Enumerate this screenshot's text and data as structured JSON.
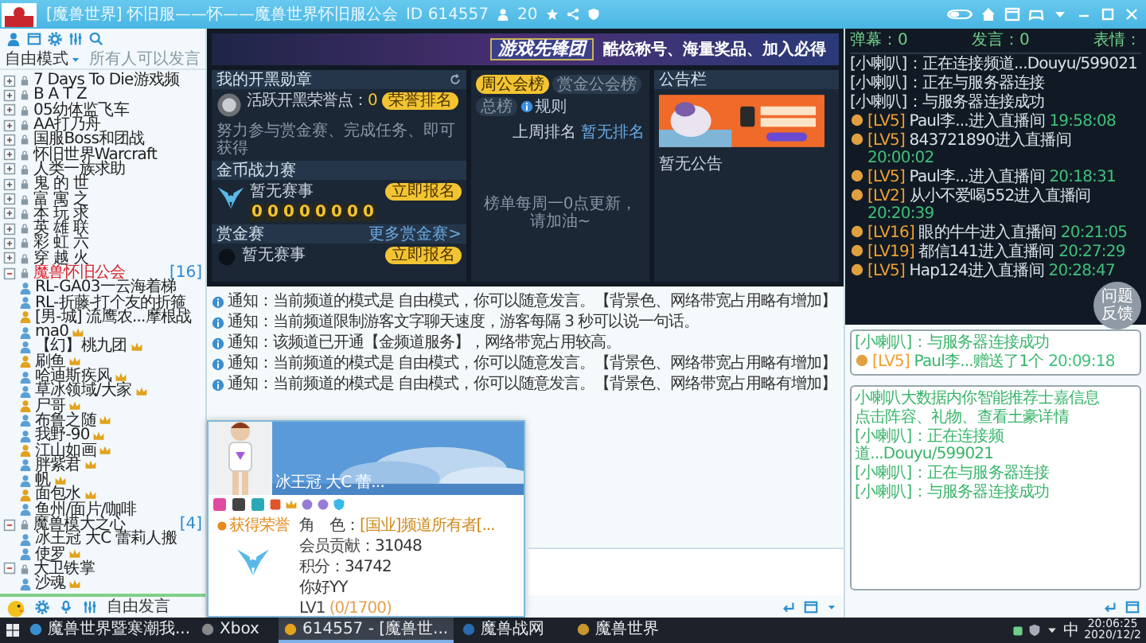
{
  "window": {
    "title": "[魔兽世界] 怀旧服——怀——魔兽世界怀旧服公会",
    "channel_id": "ID 614557",
    "online": "20"
  },
  "sidebar": {
    "mode": "自由模式",
    "speak_rule": "所有人可以发言",
    "channels": [
      {
        "name": "7 Days To Die游戏频",
        "expanded": false,
        "current": false
      },
      {
        "name": "B A T Z",
        "expanded": false,
        "current": false
      },
      {
        "name": "05幼体监飞车",
        "expanded": false,
        "current": false
      },
      {
        "name": "AA打乃舟",
        "expanded": false,
        "current": false
      },
      {
        "name": "国服Boss和团战",
        "expanded": false,
        "current": false
      },
      {
        "name": "怀旧世界Warcraft",
        "expanded": false,
        "current": false
      },
      {
        "name": "人类一族求助",
        "expanded": false,
        "current": false
      },
      {
        "name": "鬼 的 世",
        "expanded": false,
        "current": false
      },
      {
        "name": "富 寓 之",
        "expanded": false,
        "current": false
      },
      {
        "name": "本 玩 求",
        "expanded": false,
        "current": false
      },
      {
        "name": "英 雄 联",
        "expanded": false,
        "current": false
      },
      {
        "name": "彩 虹 六",
        "expanded": false,
        "current": false
      },
      {
        "name": "穿 越 火",
        "expanded": false,
        "current": false
      },
      {
        "name": "魔兽怀旧公会",
        "count": "[16]",
        "expanded": true,
        "current": true,
        "children": [
          {
            "name": "RL-GA03一云海着梯"
          },
          {
            "name": "RL-折藤-打个友的折箍"
          },
          {
            "name": "[男-城] 流鹰农...摩根战"
          },
          {
            "name": "ma0"
          },
          {
            "name": "【幻】桃九团"
          },
          {
            "name": "刷鱼"
          },
          {
            "name": "哈迪斯疾风"
          },
          {
            "name": "草冰领域/大家"
          },
          {
            "name": "尸哥"
          },
          {
            "name": "布鲁之随"
          },
          {
            "name": "我野-90"
          },
          {
            "name": "江山如画"
          },
          {
            "name": "胖紫君"
          },
          {
            "name": "帆"
          },
          {
            "name": "面包水"
          },
          {
            "name": "鱼州/面片/咖啡"
          }
        ]
      },
      {
        "name": "魔兽模大之心",
        "count": "[4]",
        "expanded": true,
        "current": false,
        "children": [
          {
            "name": "冰王冠 大C 蕾莉人搬"
          },
          {
            "name": "使罗"
          }
        ]
      },
      {
        "name": "大卫铁掌",
        "expanded": true,
        "current": false,
        "children": [
          {
            "name": "沙魂"
          }
        ]
      }
    ],
    "speak_button": "自由发言"
  },
  "banner": {
    "title": "游戏先锋团",
    "slogan": "酷炫称号、海量奖品、加入必得"
  },
  "medal_panel": {
    "title": "我的开黑勋章",
    "points_label": "活跃开黑荣誉点：",
    "points": "0",
    "button": "荣誉排名",
    "hint": "努力参与赏金赛、完成任务、即可获得"
  },
  "gold_panel": {
    "title": "金币战力赛",
    "status": "暂无赛事",
    "button": "立即报名",
    "digits": [
      "0",
      "0",
      "0",
      "0",
      "0",
      "0",
      "0",
      "0"
    ]
  },
  "bounty_panel": {
    "title": "赏金赛",
    "more": "更多赏金赛>",
    "status": "暂无赛事",
    "button": "立即报名"
  },
  "rank_panel": {
    "tabs": [
      {
        "label": "周公会榜",
        "selected": true
      },
      {
        "label": "赏金公会榜",
        "selected": false
      },
      {
        "label": "总榜",
        "selected": false
      }
    ],
    "rules": "规则",
    "last_week": "上周排名",
    "last_week_link": "暂无排名",
    "hint": "榜单每周一0点更新，请加油~"
  },
  "notice_panel": {
    "title": "公告栏",
    "empty": "暂无公告"
  },
  "notices": [
    "通知：当前频道的模式是 自由模式，你可以随意发言。【背景色、网络带宽占用略有增加】",
    "通知：当前频道限制游客文字聊天速度，游客每隔 3 秒可以说一句话。",
    "通知：该频道已开通【金频道服务】，网络带宽占用较高。",
    "通知：当前频道的模式是 自由模式，你可以随意发言。【背景色、网络带宽占用略有增加】",
    "通知：当前频道的模式是 自由模式，你可以随意发言。【背景色、网络带宽占用略有增加】"
  ],
  "profile_card": {
    "name": "冰王冠 大C 蕾...",
    "honor": "获得荣誉",
    "fields": [
      {
        "label": "角　色：",
        "value": "[国业]频道所有者[..."
      },
      {
        "label": "会员贡献：",
        "value": "31048"
      },
      {
        "label": "积分：",
        "value": "34742"
      }
    ],
    "nickname": "你好YY",
    "rank": "LV1",
    "progress": "(0/1700)"
  },
  "chat": {
    "stats": [
      "弹幕：0",
      "发言：0",
      "表情："
    ],
    "messages": [
      {
        "kind": "system",
        "prefix": "[小喇叭]：",
        "text": "正在连接频道...Douyu/599021"
      },
      {
        "kind": "system",
        "prefix": "[小喇叭]：",
        "text": "正在与服务器连接"
      },
      {
        "kind": "system",
        "prefix": "[小喇叭]：",
        "text": "与服务器连接成功"
      },
      {
        "kind": "user",
        "rank": "[LV5]",
        "text": "Paul李...进入直播间",
        "time": "19:58:08"
      },
      {
        "kind": "user",
        "rank": "[LV5]",
        "text": "843721890进入直播间",
        "time": "20:00:02"
      },
      {
        "kind": "user",
        "rank": "[LV5]",
        "text": "Paul李...进入直播间",
        "time": "20:18:31"
      },
      {
        "kind": "user",
        "rank": "[LV2]",
        "text": "从小不爱喝552进入直播间",
        "time": "20:20:39"
      },
      {
        "kind": "user",
        "rank": "[LV16]",
        "text": "眼的牛牛进入直播间",
        "time": "20:21:05"
      },
      {
        "kind": "user",
        "rank": "[LV19]",
        "text": "都信141进入直播间",
        "time": "20:27:29"
      },
      {
        "kind": "user",
        "rank": "[LV5]",
        "text": "Hap124进入直播间",
        "time": "20:28:47"
      }
    ],
    "feedback_button": "问题反馈",
    "gift_messages": [
      {
        "kind": "system",
        "prefix": "[小喇叭]：",
        "text": "与服务器连接成功"
      },
      {
        "kind": "user",
        "rank": "[LV5]",
        "text": "Paul李...赠送了1个",
        "time": "20:09:18"
      }
    ],
    "info_lines": [
      {
        "kind": "plain",
        "text": "小喇叭大数据内你智能推荐士嘉信息"
      },
      {
        "kind": "plain",
        "text": "点击阵容、礼物、查看土豪详情"
      },
      {
        "kind": "system",
        "prefix": "[小喇叭]：",
        "text": "正在连接频道...Douyu/599021"
      },
      {
        "kind": "system",
        "prefix": "[小喇叭]：",
        "text": "正在与服务器连接"
      },
      {
        "kind": "system",
        "prefix": "[小喇叭]：",
        "text": "与服务器连接成功"
      }
    ]
  },
  "taskbar": {
    "apps": [
      {
        "label": "魔兽世界暨寒潮我...",
        "selected": false
      },
      {
        "label": "Xbox",
        "selected": false
      },
      {
        "label": "614557 - [魔兽世...",
        "selected": true
      },
      {
        "label": "魔兽战网",
        "selected": false
      },
      {
        "label": "魔兽世界",
        "selected": false
      }
    ],
    "ime": "中",
    "time": "20:06:25",
    "date": "2020/12/2"
  }
}
